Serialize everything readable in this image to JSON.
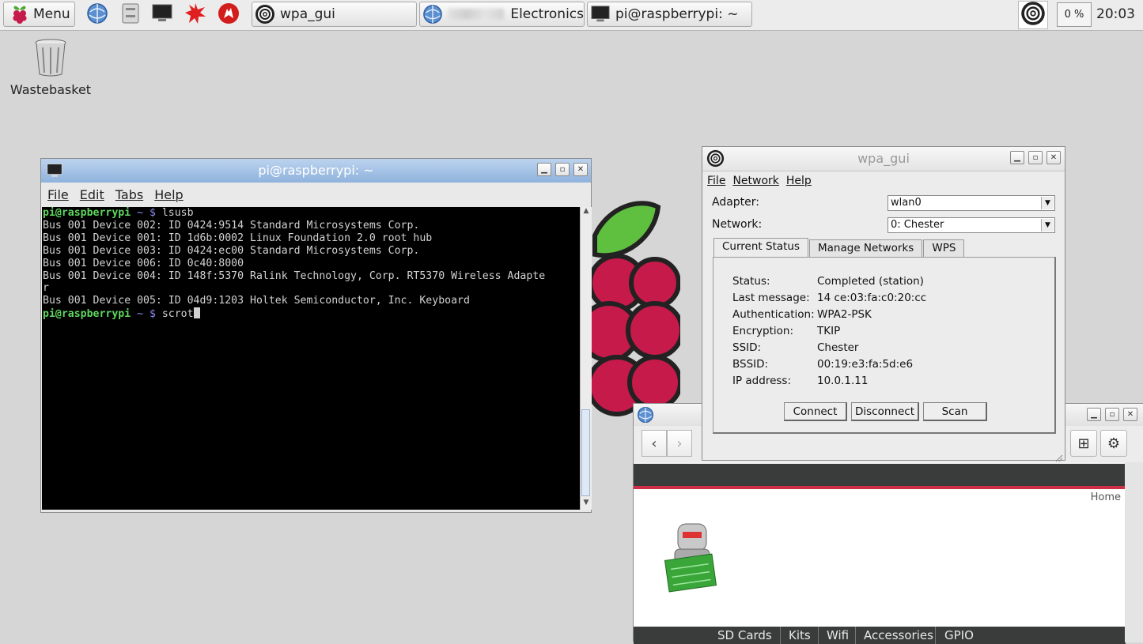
{
  "taskbar": {
    "menu_label": "Menu",
    "tasks": [
      {
        "label": "wpa_gui",
        "icon": "wpa-icon"
      },
      {
        "label": "Electronics",
        "icon": "browser-icon"
      },
      {
        "label": "pi@raspberrypi: ~",
        "icon": "terminal-icon"
      }
    ],
    "launchers": [
      "browser-icon",
      "file-manager-icon",
      "terminal-icon",
      "math-kernel-icon",
      "wolfram-icon"
    ],
    "cpu": "0 %",
    "clock": "20:03"
  },
  "desktop": {
    "wastebasket_label": "Wastebasket"
  },
  "terminal": {
    "title": "pi@raspberrypi: ~",
    "menu": [
      "File",
      "Edit",
      "Tabs",
      "Help"
    ],
    "prompt_host": "pi@raspberrypi",
    "prompt_sep": " ~ $",
    "command1": " lsusb",
    "output": [
      "Bus 001 Device 002: ID 0424:9514 Standard Microsystems Corp.",
      "Bus 001 Device 001: ID 1d6b:0002 Linux Foundation 2.0 root hub",
      "Bus 001 Device 003: ID 0424:ec00 Standard Microsystems Corp.",
      "Bus 001 Device 006: ID 0c40:8000",
      "Bus 001 Device 004: ID 148f:5370 Ralink Technology, Corp. RT5370 Wireless Adapte",
      "r",
      "Bus 001 Device 005: ID 04d9:1203 Holtek Semiconductor, Inc. Keyboard"
    ],
    "command2": " scrot"
  },
  "wpa": {
    "title": "wpa_gui",
    "menu": [
      "File",
      "Network",
      "Help"
    ],
    "adapter_label": "Adapter:",
    "adapter_value": "wlan0",
    "network_label": "Network:",
    "network_value": "0: Chester",
    "tabs": [
      "Current Status",
      "Manage Networks",
      "WPS"
    ],
    "status": [
      {
        "label": "Status:",
        "value": "Completed (station)"
      },
      {
        "label": "Last message:",
        "value": "14 ce:03:fa:c0:20:cc"
      },
      {
        "label": "Authentication:",
        "value": "WPA2-PSK"
      },
      {
        "label": "Encryption:",
        "value": "TKIP"
      },
      {
        "label": "SSID:",
        "value": "Chester"
      },
      {
        "label": "BSSID:",
        "value": "00:19:e3:fa:5d:e6"
      },
      {
        "label": "IP address:",
        "value": "10.0.1.11"
      }
    ],
    "buttons": {
      "connect": "Connect",
      "disconnect": "Disconnect",
      "scan": "Scan"
    }
  },
  "browser": {
    "home_link": "Home",
    "nav": [
      "SD Cards",
      "Kits",
      "Wifi",
      "Accessories",
      "GPIO"
    ]
  },
  "colors": {
    "terminal_title": "#8fb2dc",
    "prompt_host": "#5fd75f",
    "site_accent": "#cf2f46",
    "site_bar": "#3a3c3b"
  }
}
